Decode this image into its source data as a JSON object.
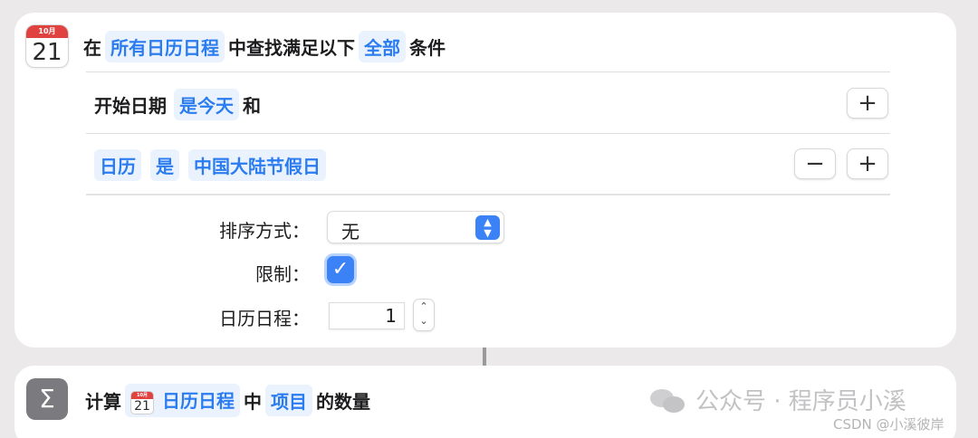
{
  "find_action": {
    "calendar_icon": {
      "month": "10月",
      "day": "21"
    },
    "header": {
      "prefix": "在",
      "source": "所有日历日程",
      "middle": "中查找满足以下",
      "match": "全部",
      "suffix": "条件"
    },
    "filters": [
      {
        "field": "开始日期",
        "operator": "是今天",
        "connector": "和"
      },
      {
        "field": "日历",
        "operator": "是",
        "value": "中国大陆节假日"
      }
    ],
    "sort": {
      "label": "排序方式：",
      "value": "无"
    },
    "limit": {
      "label": "限制：",
      "checked": true,
      "check_glyph": "✓"
    },
    "count": {
      "label": "日历日程：",
      "value": "1"
    },
    "button_glyphs": {
      "add": "+",
      "remove": "−"
    }
  },
  "count_action": {
    "icon_glyph": "Σ",
    "prefix": "计算",
    "mini_calendar": {
      "month": "10月",
      "day": "21"
    },
    "variable": "日历日程",
    "middle": "中",
    "unit": "项目",
    "suffix": "的数量"
  },
  "watermark": {
    "text": "公众号 · 程序员小溪",
    "credit": "CSDN @小溪彼岸"
  }
}
